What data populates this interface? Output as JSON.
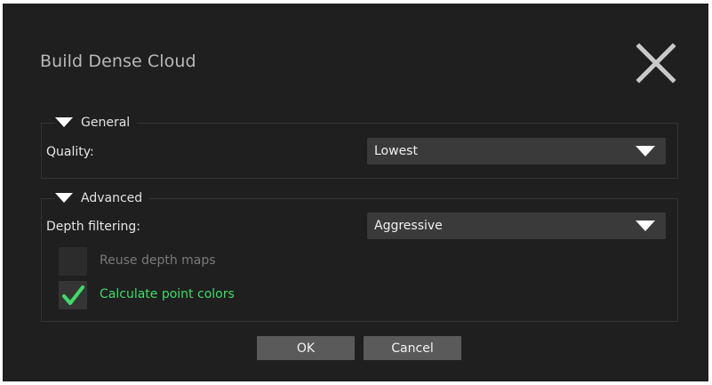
{
  "dialog": {
    "title": "Build Dense Cloud",
    "close_icon": "close-x-icon"
  },
  "general": {
    "legend": "General",
    "quality_label": "Quality:",
    "quality_value": "Lowest"
  },
  "advanced": {
    "legend": "Advanced",
    "depth_filtering_label": "Depth filtering:",
    "depth_filtering_value": "Aggressive",
    "reuse_depth_maps_label": "Reuse depth maps",
    "reuse_depth_maps_checked": false,
    "reuse_depth_maps_enabled": false,
    "calc_point_colors_label": "Calculate point colors",
    "calc_point_colors_checked": true
  },
  "buttons": {
    "ok": "OK",
    "cancel": "Cancel"
  },
  "colors": {
    "background": "#1f1f1f",
    "accent_green": "#3ddc67",
    "button": "#5a5a5a",
    "select": "#3a3a3a"
  }
}
